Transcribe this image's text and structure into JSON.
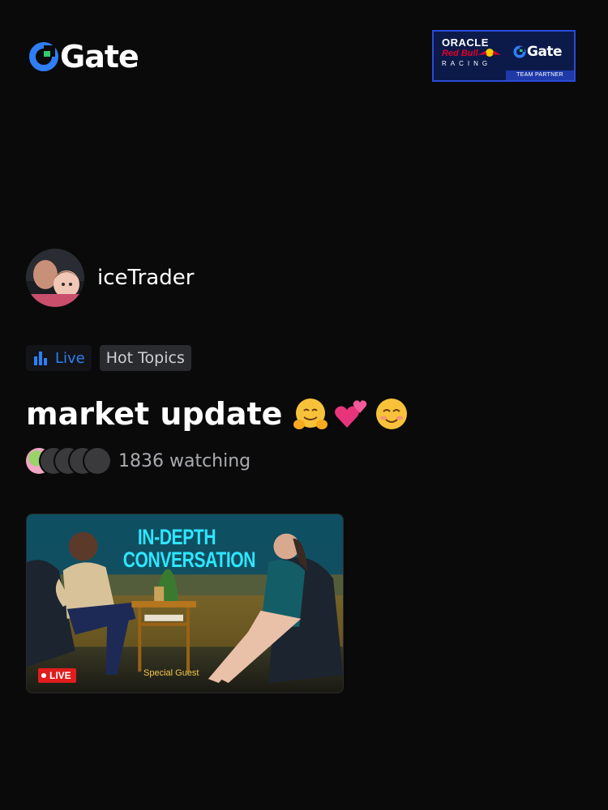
{
  "brand": {
    "name": "Gate",
    "accent": "#2f7ef5"
  },
  "partner_badge": {
    "line1": "ORACLE",
    "line2": "Red Bull",
    "line3": "RACING",
    "partner_name": "Gate",
    "footer": "TEAM PARTNER"
  },
  "stream": {
    "username": "iceTrader",
    "tags": [
      {
        "label": "Live",
        "icon": "bar-chart-icon",
        "color": "#2f7ef5"
      },
      {
        "label": "Hot Topics"
      }
    ],
    "title": "market update",
    "title_emojis": [
      "hugging-face-emoji",
      "two-hearts-emoji",
      "smiling-face-emoji"
    ],
    "viewer_avatars": 4,
    "watching_text": "1836 watching"
  },
  "thumbnail": {
    "headline": "IN-DEPTH\nCONVERSATION",
    "caption": "Special Guest",
    "live_badge": "LIVE",
    "live_color": "#e11d1d"
  }
}
